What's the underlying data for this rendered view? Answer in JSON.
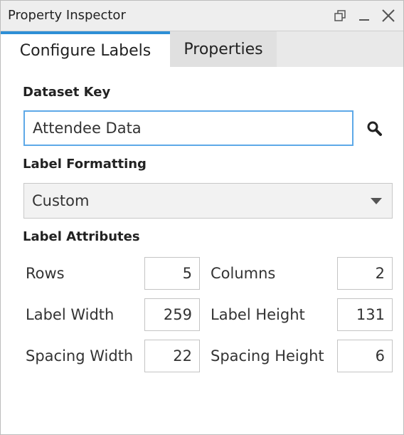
{
  "window": {
    "title": "Property Inspector",
    "controls": {
      "restore_icon": "restore-icon",
      "minimize_icon": "minimize-icon",
      "close_icon": "close-icon"
    }
  },
  "tabs": [
    {
      "label": "Configure Labels",
      "active": true
    },
    {
      "label": "Properties",
      "active": false
    }
  ],
  "dataset_key": {
    "label": "Dataset Key",
    "value": "Attendee Data",
    "search_icon": "search-icon"
  },
  "label_formatting": {
    "label": "Label Formatting",
    "selected": "Custom",
    "dropdown_icon": "triangle-down-icon"
  },
  "label_attributes": {
    "label": "Label Attributes",
    "rows_label": "Rows",
    "rows_value": "5",
    "columns_label": "Columns",
    "columns_value": "2",
    "label_width_label": "Label Width",
    "label_width_value": "259",
    "label_height_label": "Label Height",
    "label_height_value": "131",
    "spacing_width_label": "Spacing Width",
    "spacing_width_value": "22",
    "spacing_height_label": "Spacing Height",
    "spacing_height_value": "6"
  },
  "colors": {
    "accent": "#2e8fd6",
    "focus_border": "#5ea9e8"
  }
}
